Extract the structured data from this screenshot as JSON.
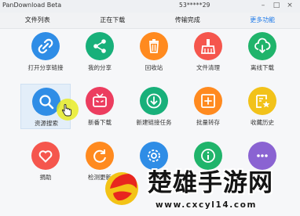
{
  "app": {
    "title": "PanDownload Beta",
    "user": "53*****29"
  },
  "window_controls": [
    "–",
    "□",
    "×"
  ],
  "tabs": [
    {
      "label": "文件列表",
      "active": false
    },
    {
      "label": "正在下载",
      "active": false
    },
    {
      "label": "传输完成",
      "active": false
    },
    {
      "label": "更多功能",
      "active": true
    }
  ],
  "accent_color": "#1f7ae8",
  "features": [
    {
      "label": "打开分享链接",
      "icon": "link-icon",
      "color": "#2f8de6"
    },
    {
      "label": "我的分享",
      "icon": "share-icon",
      "color": "#18b07a"
    },
    {
      "label": "回收站",
      "icon": "trash-icon",
      "color": "#ff8a1f"
    },
    {
      "label": "文件清理",
      "icon": "broom-icon",
      "color": "#f5564d"
    },
    {
      "label": "离线下载",
      "icon": "cloud-download-icon",
      "color": "#20b46b"
    },
    {
      "label": "资源搜索",
      "icon": "search-icon",
      "color": "#2f8de6"
    },
    {
      "label": "新番下载",
      "icon": "tv-icon",
      "color": "#ec3d5f"
    },
    {
      "label": "新建链接任务",
      "icon": "download-circle-icon",
      "color": "#18b07a"
    },
    {
      "label": "批量转存",
      "icon": "batch-save-icon",
      "color": "#ff8a1f"
    },
    {
      "label": "收藏历史",
      "icon": "star-list-icon",
      "color": "#f2c21a"
    },
    {
      "label": "捐助",
      "icon": "heart-icon",
      "color": "#f5564d"
    },
    {
      "label": "检测更新",
      "icon": "refresh-icon",
      "color": "#ff8a1f"
    },
    {
      "label": "",
      "icon": "settings-icon",
      "color": "#2f8de6"
    },
    {
      "label": "",
      "icon": "about-icon",
      "color": "#20b46b"
    },
    {
      "label": "",
      "icon": "misc-icon",
      "color": "#8a63d2"
    }
  ],
  "watermark": {
    "text": "楚雄手游网",
    "url": "www.cxcyl14.com"
  }
}
